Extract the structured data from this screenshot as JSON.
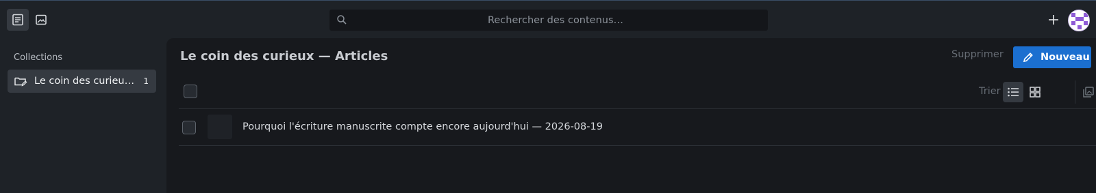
{
  "topbar": {
    "search": {
      "placeholder": "Rechercher des contenus…"
    },
    "icons": {
      "articles": "document-icon",
      "media": "image-icon",
      "add": "plus-icon",
      "user": "avatar"
    }
  },
  "sidebar": {
    "heading": "Collections",
    "items": [
      {
        "label": "Le coin des curieux — Articles",
        "count": "1",
        "icon": "folder-edit-icon"
      }
    ]
  },
  "main": {
    "title": "Le coin des curieux — Articles",
    "actions": {
      "delete_label": "Supprimer",
      "new_label": "Nouveau"
    },
    "toolbar": {
      "sort_label": "Trier"
    },
    "entries": [
      {
        "title": "Pourquoi l'écriture manuscrite compte encore aujourd'hui — 2026-08-19"
      }
    ]
  },
  "colors": {
    "accent": "#1b6fd0",
    "background": "#1e2227",
    "content_background": "#17191d",
    "active_item": "#353a41"
  }
}
